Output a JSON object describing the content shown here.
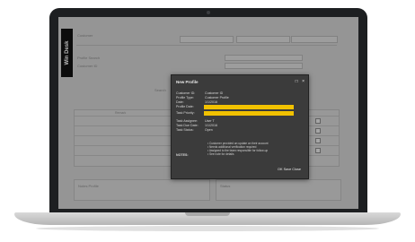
{
  "app": {
    "logo_text": "Win Desk"
  },
  "background": {
    "header_fields": [
      "",
      "",
      "",
      ""
    ],
    "table_headers": [
      "Remark",
      "Status",
      "",
      ""
    ],
    "table_rows": [
      [
        "",
        "",
        ""
      ],
      [
        "",
        "",
        ""
      ],
      [
        "",
        "",
        ""
      ],
      [
        "",
        "",
        ""
      ],
      [
        "",
        "",
        ""
      ]
    ],
    "panels": [
      "Notes Profile",
      "Status"
    ]
  },
  "modal": {
    "title": "New Profile",
    "controls": [
      "□",
      "×"
    ],
    "fields": [
      {
        "label": "Customer ID:",
        "value": "Customer ID"
      },
      {
        "label": "Profile Type:",
        "value": "Customer Profile"
      },
      {
        "label": "Date:",
        "value": "1/1/2016"
      },
      {
        "label": "Profile Date:",
        "value": ""
      },
      {
        "label": "Task Priority:",
        "value": ""
      },
      {
        "label": "Task Assignee:",
        "value": "User T"
      },
      {
        "label": "Task Due Date:",
        "value": "1/1/2016"
      },
      {
        "label": "Task Status:",
        "value": "Open"
      }
    ],
    "notes_label": "NOTES:",
    "notes_lines": [
      "• Customer provided an update on their account",
      "• Needs additional verification required",
      "• Assigned to the team responsible for follow-up",
      "• See note for details"
    ],
    "button_label": "OK Save Close"
  },
  "colors": {
    "accent": "#f2c200",
    "modal_bg": "#3b3b3b",
    "laptop_frame": "#1d1f21"
  }
}
